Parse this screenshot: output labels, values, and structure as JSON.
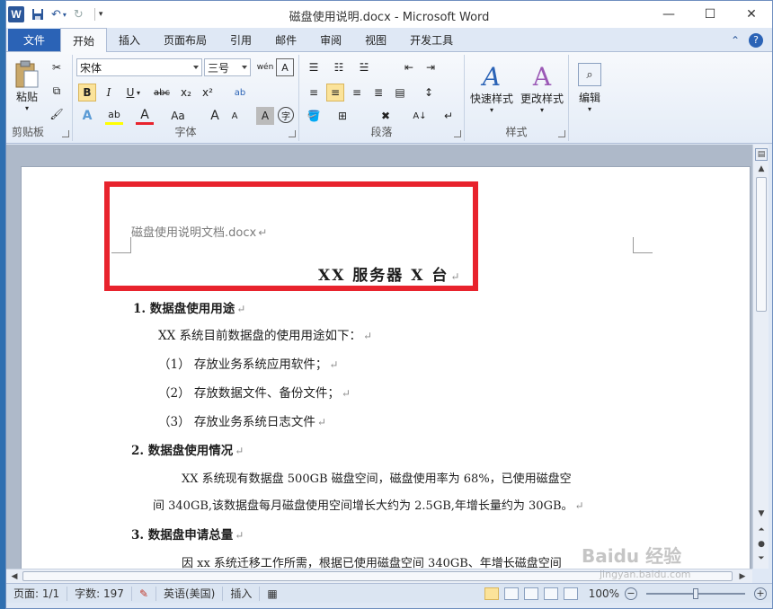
{
  "window": {
    "title": "磁盘使用说明.docx - Microsoft Word",
    "app_badge": "W",
    "minimize": "—",
    "maximize": "☐",
    "close": "✕"
  },
  "tabs": {
    "file": "文件",
    "items": [
      "开始",
      "插入",
      "页面布局",
      "引用",
      "邮件",
      "审阅",
      "视图",
      "开发工具"
    ],
    "help": "?"
  },
  "ribbon": {
    "clipboard": {
      "paste": "粘贴",
      "label": "剪贴板"
    },
    "font": {
      "family": "宋体",
      "size": "三号",
      "label": "字体",
      "bold": "B",
      "italic": "I",
      "underline": "U",
      "strike": "abc",
      "subscript": "x₂",
      "superscript": "x²",
      "change_case": "Aa",
      "grow": "A",
      "shrink": "A",
      "char_border": "A",
      "enclose": "字",
      "text_effect": "A",
      "highlight": "ab",
      "color": "A",
      "phonetic": "wén"
    },
    "paragraph": {
      "label": "段落"
    },
    "styles": {
      "quick": "快速样式",
      "change": "更改样式",
      "label": "样式"
    },
    "editing": {
      "label": "编辑"
    }
  },
  "document": {
    "header_text": "磁盘使用说明文档.docx",
    "title": "XX 服务器 X 台",
    "para_mark": "↵",
    "lines": [
      "1.  数据盘使用用途",
      "XX 系统目前数据盘的使用用途如下：",
      "（1）  存放业务系统应用软件；",
      "（2）  存放数据文件、备份文件；",
      "（3）  存放业务系统日志文件",
      "2. 数据盘使用情况",
      "XX 系统现有数据盘 500GB 磁盘空间，磁盘使用率为 68%，已使用磁盘空",
      "间 340GB,该数据盘每月磁盘使用空间增长大约为 2.5GB,年增长量约为 30GB。",
      "3. 数据盘申请总量",
      "因 xx 系统迁移工作所需，根据已使用磁盘空间 340GB、年增长磁盘空间"
    ]
  },
  "statusbar": {
    "page": "页面: 1/1",
    "words": "字数: 197",
    "language": "英语(美国)",
    "insert": "插入",
    "zoom": "100%",
    "zoom_out": "−",
    "zoom_in": "+"
  },
  "watermark": {
    "main": "Baidu 经验",
    "sub": "jingyan.baidu.com"
  },
  "colors": {
    "accent": "#2b63b6",
    "highlight_box": "#e8232d",
    "font_color": "#e8232d"
  }
}
